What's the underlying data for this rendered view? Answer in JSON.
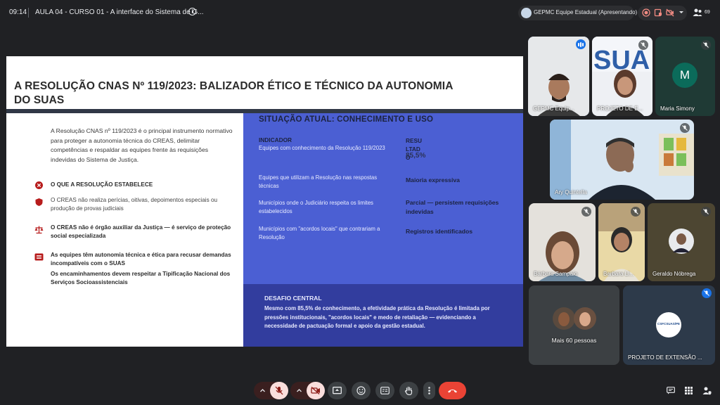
{
  "topbar": {
    "time": "09:14",
    "meeting_title": "AULA 04 - CURSO 01 - A interface do Sistema de G...",
    "presenting_label": "GEPMC Equipe Estadual (Apresentando)",
    "participant_count": "69"
  },
  "slide": {
    "title": "A RESOLUÇÃO CNAS Nº 119/2023: BALIZADOR ÉTICO E TÉCNICO DA AUTONOMIA DO SUAS",
    "intro": "A Resolução CNAS nº 119/2023 é o principal instrumento normativo para proteger a autonomia técnica do CREAS, delimitar competências e respaldar as equipes frente às requisições indevidas do Sistema de Justiça.",
    "items": [
      {
        "text": "O QUE A RESOLUÇÃO ESTABELECE",
        "icon": "x-circle-icon",
        "bold": true
      },
      {
        "text": "O CREAS não realiza perícias, oitivas, depoimentos especiais ou produção de provas judiciais",
        "icon": "shield-icon",
        "bold": false
      },
      {
        "text": "O CREAS não é órgão auxiliar da Justiça — é serviço de proteção social especializada",
        "icon": "scale-icon",
        "bold": true
      },
      {
        "text": "As equipes têm autonomia técnica e ética para recusar demandas incompatíveis com o SUAS",
        "icon": "list-icon",
        "bold": true
      },
      {
        "text": "Os encaminhamentos devem respeitar a Tipificação Nacional dos Serviços Socioassistenciais",
        "bold": true
      }
    ],
    "situacao": {
      "heading": "SITUAÇÃO ATUAL: CONHECIMENTO E USO",
      "col_indicator": "INDICADOR",
      "col_result": "RESULTADO",
      "rows": [
        {
          "indicator": "Equipes com conhecimento da Resolução 119/2023",
          "result": "85,5%"
        },
        {
          "indicator": "Equipes que utilizam a Resolução nas respostas técnicas",
          "result": "Maioria expressiva"
        },
        {
          "indicator": "Municípios onde o Judiciário respeita os limites estabelecidos",
          "result": "Parcial — persistem requisições indevidas"
        },
        {
          "indicator": "Municípios com \"acordos locais\" que contrariam a Resolução",
          "result": "Registros identificados"
        }
      ]
    },
    "desafio": {
      "heading": "DESAFIO CENTRAL",
      "text": "Mesmo com 85,5% de conhecimento, a efetividade prática da Resolução é limitada por pressões institucionais, \"acordos locais\" e medo de retaliação — evidenciando a necessidade de pactuação formal e apoio da gestão estadual."
    }
  },
  "participants": [
    {
      "name": "GEPMC Equip...",
      "speaking": true
    },
    {
      "name": "PROJETO DE E...",
      "muted": true
    },
    {
      "name": "Maria Simony",
      "initial": "M",
      "muted": true
    },
    {
      "name": "Ary Quintella",
      "muted": true
    },
    {
      "name": "Bárbara Sampaio",
      "muted": true
    },
    {
      "name": "Barbara Ll...",
      "muted": true
    },
    {
      "name": "Geraldo Nóbrega",
      "muted": true
    },
    {
      "name": "Mais 60 pessoas"
    },
    {
      "name": "PROJETO DE EXTENSÃO ...",
      "logo_text": "CSFCSUAS/PE",
      "muted": true
    }
  ],
  "colors": {
    "slide_blue": "#4b5fd3",
    "slide_dark_blue": "#323d9e",
    "end_call": "#ea4335",
    "bullet_red": "#c62828"
  }
}
